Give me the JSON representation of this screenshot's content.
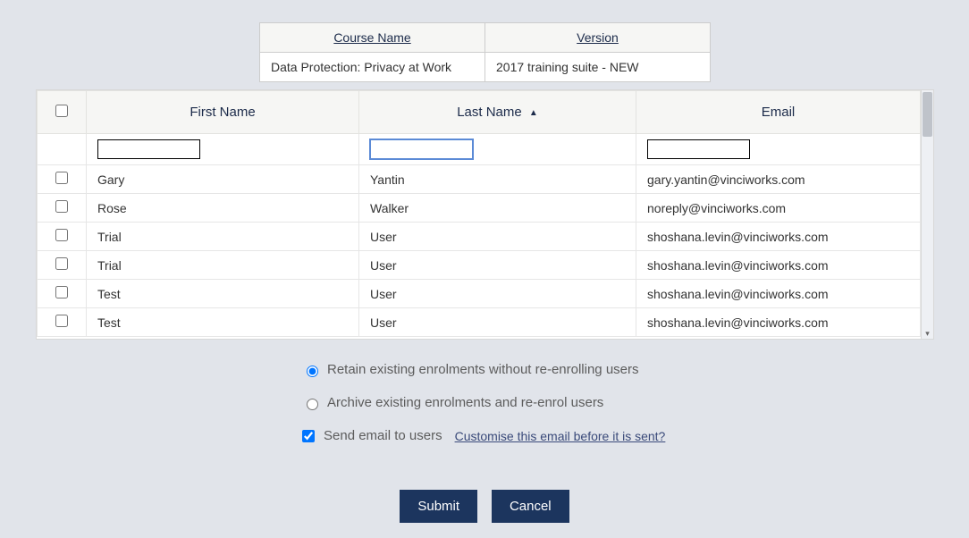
{
  "course_table": {
    "headers": {
      "name": "Course Name",
      "version": "Version"
    },
    "row": {
      "name": "Data Protection: Privacy at Work",
      "version": "2017 training suite - NEW"
    }
  },
  "users_table": {
    "headers": {
      "first": "First Name",
      "last": "Last Name",
      "email": "Email"
    },
    "sort_column": "last",
    "sort_dir": "asc",
    "filters": {
      "first": "",
      "last": "",
      "email": ""
    },
    "rows": [
      {
        "first": "Gary",
        "last": "Yantin",
        "email": "gary.yantin@vinciworks.com"
      },
      {
        "first": "Rose",
        "last": "Walker",
        "email": "noreply@vinciworks.com"
      },
      {
        "first": "Trial",
        "last": "User",
        "email": "shoshana.levin@vinciworks.com"
      },
      {
        "first": "Trial",
        "last": "User",
        "email": "shoshana.levin@vinciworks.com"
      },
      {
        "first": "Test",
        "last": "User",
        "email": "shoshana.levin@vinciworks.com"
      },
      {
        "first": "Test",
        "last": "User",
        "email": "shoshana.levin@vinciworks.com"
      }
    ]
  },
  "options": {
    "retain_label": "Retain existing enrolments without re-enrolling users",
    "archive_label": "Archive existing enrolments and re-enrol users",
    "send_email_label": "Send email to users",
    "customise_link": "Customise this email before it is sent?",
    "selected_mode": "retain",
    "send_email_checked": true
  },
  "buttons": {
    "submit": "Submit",
    "cancel": "Cancel"
  }
}
